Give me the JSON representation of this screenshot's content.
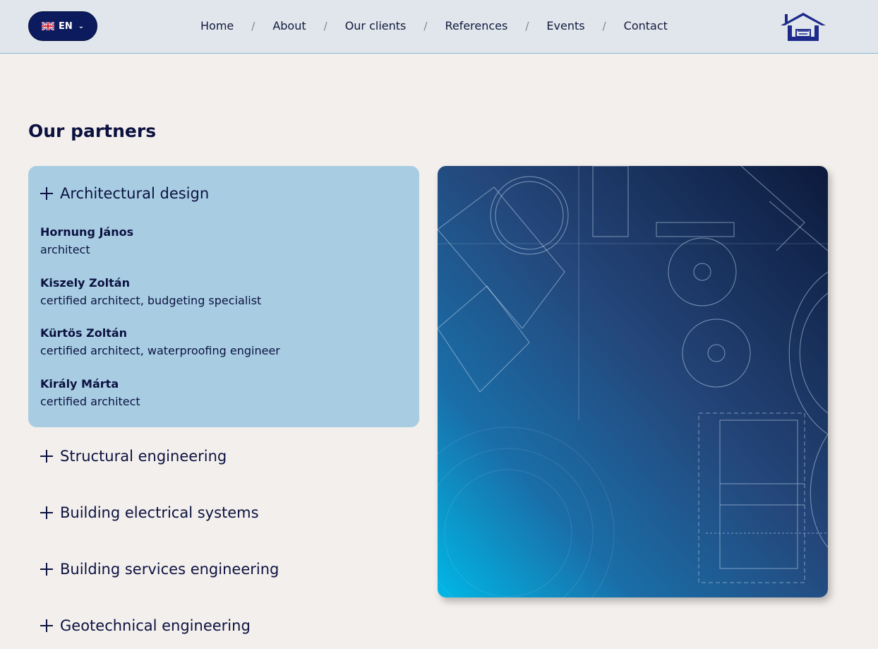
{
  "header": {
    "language": {
      "code": "EN",
      "flag": "uk-flag-icon"
    },
    "nav": [
      "Home",
      "About",
      "Our clients",
      "References",
      "Events",
      "Contact"
    ],
    "nav_separator": "/"
  },
  "page_title": "Our partners",
  "categories": [
    {
      "name": "Architectural design",
      "expanded": true,
      "members": [
        {
          "name": "Hornung János",
          "role": "architect"
        },
        {
          "name": "Kiszely Zoltán",
          "role": "certified architect, budgeting specialist"
        },
        {
          "name": "Kürtös Zoltán",
          "role": "certified architect, waterproofing engineer"
        },
        {
          "name": "Király Márta",
          "role": "certified architect"
        }
      ]
    },
    {
      "name": "Structural engineering",
      "expanded": false
    },
    {
      "name": "Building electrical systems",
      "expanded": false
    },
    {
      "name": "Building services engineering",
      "expanded": false
    },
    {
      "name": "Geotechnical engineering",
      "expanded": false
    }
  ],
  "colors": {
    "navy": "#0c1a5e",
    "accordion_open_bg": "#a8cde3",
    "page_bg": "#f3efec",
    "header_bg": "#e0e6ec"
  }
}
